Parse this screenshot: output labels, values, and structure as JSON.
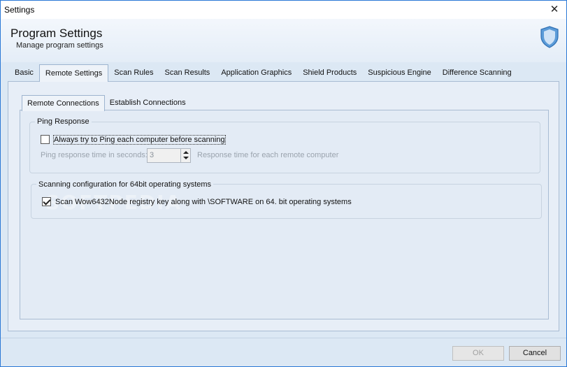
{
  "window": {
    "title": "Settings"
  },
  "header": {
    "title": "Program Settings",
    "subtitle": "Manage program settings"
  },
  "tabs": [
    {
      "label": "Basic"
    },
    {
      "label": "Remote Settings",
      "active": true
    },
    {
      "label": "Scan Rules"
    },
    {
      "label": "Scan Results"
    },
    {
      "label": "Application Graphics"
    },
    {
      "label": "Shield Products"
    },
    {
      "label": "Suspicious Engine"
    },
    {
      "label": "Difference Scanning"
    }
  ],
  "subtabs": [
    {
      "label": "Remote Connections",
      "active": true
    },
    {
      "label": "Establish Connections"
    }
  ],
  "ping_group": {
    "title": "Ping Response",
    "checkbox_label": "Always try to Ping each computer before scanning",
    "checked": false,
    "time_label": "Ping response time in seconds:",
    "time_value": "3",
    "time_hint": "Response time for each remote computer"
  },
  "scan64_group": {
    "title": "Scanning configuration for 64bit operating systems",
    "checkbox_label": "Scan Wow6432Node registry key along with \\SOFTWARE on 64. bit operating systems",
    "checked": true
  },
  "watermark": "SOFTPEDIA",
  "footer": {
    "ok_label": "OK",
    "cancel_label": "Cancel"
  },
  "colors": {
    "window_border": "#2b79d6",
    "background": "#dce8f4",
    "shield": "#4a90d9"
  },
  "icons": {
    "close": "close-icon",
    "shield": "shield-icon"
  }
}
